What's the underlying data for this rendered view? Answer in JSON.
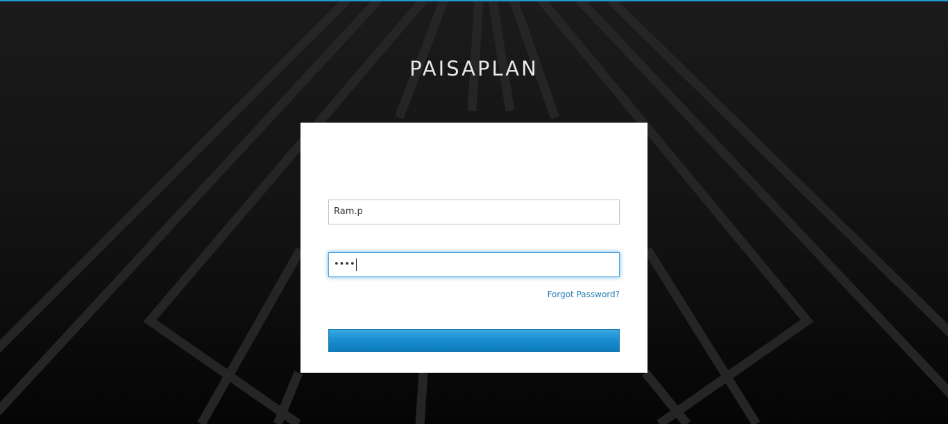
{
  "app": {
    "brand_title": "PAISAPLAN",
    "accent_color": "#1e9ad6"
  },
  "login": {
    "username_value": "Ram.p",
    "password_masked": "••••",
    "forgot_password_label": "Forgot Password?",
    "submit_label": ""
  }
}
